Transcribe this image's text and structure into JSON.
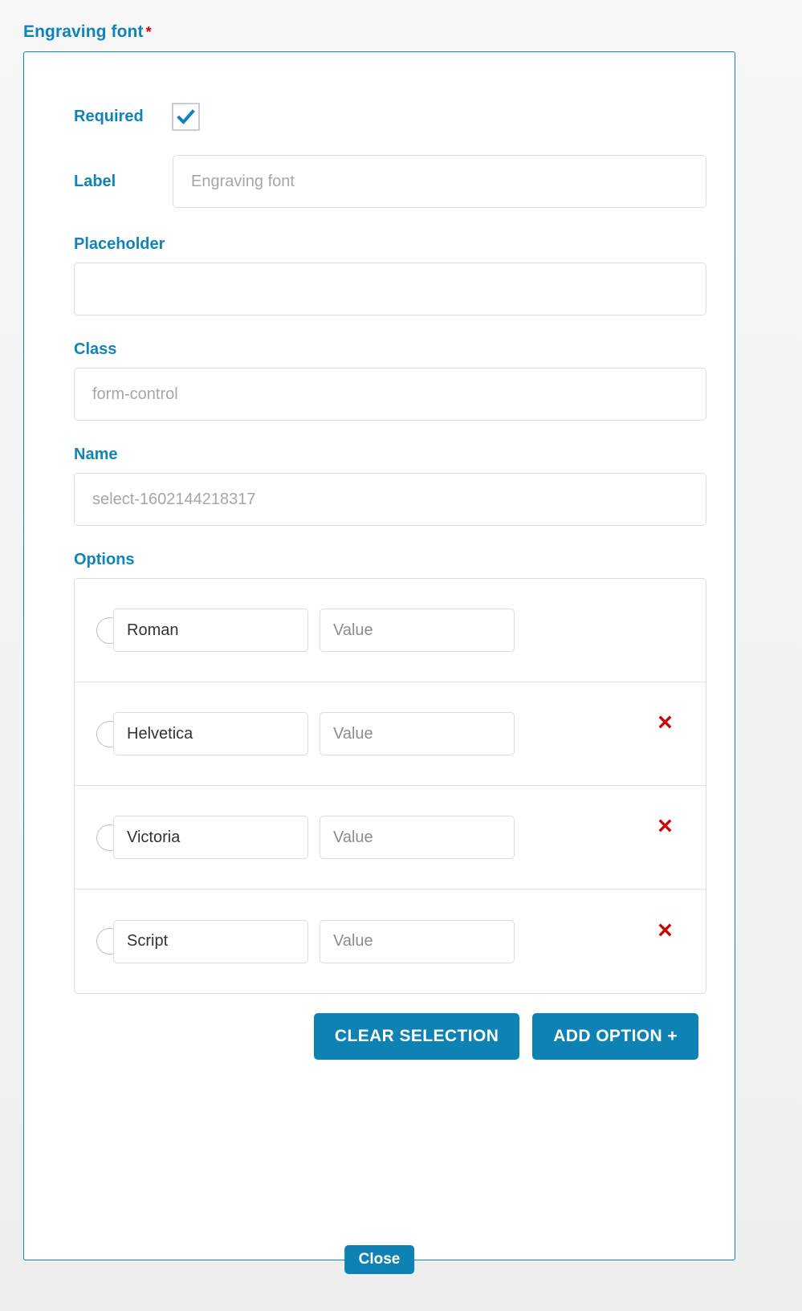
{
  "field": {
    "heading": "Engraving font",
    "required_marker": "*"
  },
  "panel": {
    "required": {
      "label": "Required",
      "checked": true,
      "icon": "check-icon"
    },
    "label_field": {
      "label": "Label",
      "value": "",
      "placeholder": "Engraving font"
    },
    "placeholder_field": {
      "label": "Placeholder",
      "value": "",
      "placeholder": ""
    },
    "class_field": {
      "label": "Class",
      "value": "",
      "placeholder": "form-control"
    },
    "name_field": {
      "label": "Name",
      "value": "",
      "placeholder": "select-1602144218317"
    },
    "options": {
      "label": "Options",
      "value_placeholder": "Value",
      "remove_icon": "close-x-icon",
      "items": [
        {
          "text": "Roman",
          "value": "",
          "selected": false,
          "removable": false
        },
        {
          "text": "Helvetica",
          "value": "",
          "selected": false,
          "removable": true
        },
        {
          "text": "Victoria",
          "value": "",
          "selected": false,
          "removable": true
        },
        {
          "text": "Script",
          "value": "",
          "selected": false,
          "removable": true
        }
      ],
      "actions": {
        "clear_selection": "CLEAR SELECTION",
        "add_option": "ADD OPTION +"
      }
    },
    "close_label": "Close"
  },
  "colors": {
    "accent": "#1083b8",
    "button": "#0e82b4",
    "required_star": "#cc0000",
    "remove": "#d00000",
    "border": "#dddddd"
  }
}
